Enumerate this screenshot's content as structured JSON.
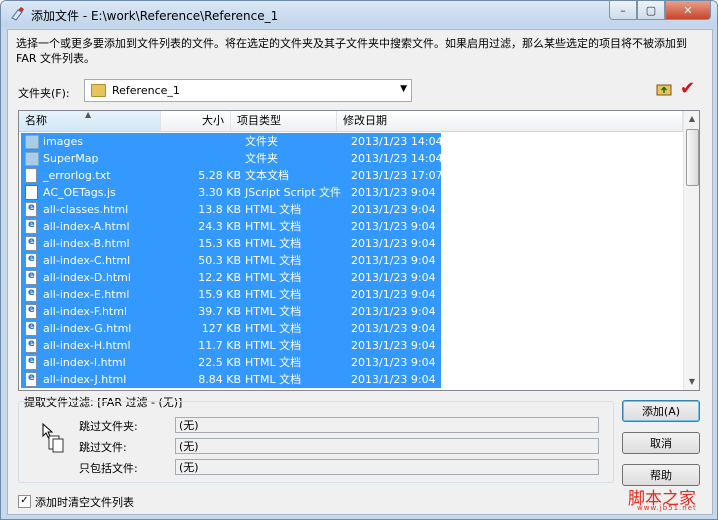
{
  "window": {
    "title": "添加文件 - E:\\work\\Reference\\Reference_1",
    "minimize_glyph": "–",
    "maximize_glyph": "▢",
    "close_glyph": "✕"
  },
  "description": "选择一个或更多要添加到文件列表的文件。将在选定的文件夹及其子文件夹中搜索文件。如果启用过滤，那么某些选定的项目将不被添加到 FAR 文件列表。",
  "folder": {
    "label": "文件夹(F):",
    "value": "Reference_1",
    "dropdown_glyph": "▼"
  },
  "toolbar": {
    "check_glyph": "✔"
  },
  "list": {
    "columns": [
      "名称",
      "大小",
      "项目类型",
      "修改日期"
    ],
    "sort_glyph": "▲",
    "rows": [
      {
        "icon": "folder",
        "name": "images",
        "size": "",
        "type": "文件夹",
        "date": "2013/1/23 14:04"
      },
      {
        "icon": "folder",
        "name": "SuperMap",
        "size": "",
        "type": "文件夹",
        "date": "2013/1/23 14:04"
      },
      {
        "icon": "doc",
        "name": "_errorlog.txt",
        "size": "5.28 KB",
        "type": "文本文档",
        "date": "2013/1/23 17:07"
      },
      {
        "icon": "js",
        "name": "AC_OETags.js",
        "size": "3.30 KB",
        "type": "JScript Script 文件",
        "date": "2013/1/23 9:04"
      },
      {
        "icon": "html",
        "name": "all-classes.html",
        "size": "13.8 KB",
        "type": "HTML 文档",
        "date": "2013/1/23 9:04"
      },
      {
        "icon": "html",
        "name": "all-index-A.html",
        "size": "24.3 KB",
        "type": "HTML 文档",
        "date": "2013/1/23 9:04"
      },
      {
        "icon": "html",
        "name": "all-index-B.html",
        "size": "15.3 KB",
        "type": "HTML 文档",
        "date": "2013/1/23 9:04"
      },
      {
        "icon": "html",
        "name": "all-index-C.html",
        "size": "50.3 KB",
        "type": "HTML 文档",
        "date": "2013/1/23 9:04"
      },
      {
        "icon": "html",
        "name": "all-index-D.html",
        "size": "12.2 KB",
        "type": "HTML 文档",
        "date": "2013/1/23 9:04"
      },
      {
        "icon": "html",
        "name": "all-index-E.html",
        "size": "15.9 KB",
        "type": "HTML 文档",
        "date": "2013/1/23 9:04"
      },
      {
        "icon": "html",
        "name": "all-index-F.html",
        "size": "39.7 KB",
        "type": "HTML 文档",
        "date": "2013/1/23 9:04"
      },
      {
        "icon": "html",
        "name": "all-index-G.html",
        "size": "127 KB",
        "type": "HTML 文档",
        "date": "2013/1/23 9:04"
      },
      {
        "icon": "html",
        "name": "all-index-H.html",
        "size": "11.7 KB",
        "type": "HTML 文档",
        "date": "2013/1/23 9:04"
      },
      {
        "icon": "html",
        "name": "all-index-I.html",
        "size": "22.5 KB",
        "type": "HTML 文档",
        "date": "2013/1/23 9:04"
      },
      {
        "icon": "html",
        "name": "all-index-J.html",
        "size": "8.84 KB",
        "type": "HTML 文档",
        "date": "2013/1/23 9:04"
      }
    ],
    "scroll_up_glyph": "▲",
    "scroll_down_glyph": "▼"
  },
  "filter": {
    "title": "提取文件过滤: [FAR 过滤 - (无)]",
    "skip_folders_label": "跳过文件夹:",
    "skip_folders_value": "(无)",
    "skip_files_label": "跳过文件:",
    "skip_files_value": "(无)",
    "include_only_label": "只包括文件:",
    "include_only_value": "(无)"
  },
  "buttons": {
    "add": "添加(A)",
    "cancel": "取消",
    "help": "帮助"
  },
  "clear_list": {
    "checked_glyph": "✓",
    "label": "添加时清空文件列表"
  },
  "watermark": {
    "text": "脚本之家",
    "sub": "www.jb51.net"
  },
  "colors": {
    "selection": "#3399ff",
    "title_bar": "#c7d8ea",
    "close_button": "#c8452a"
  }
}
